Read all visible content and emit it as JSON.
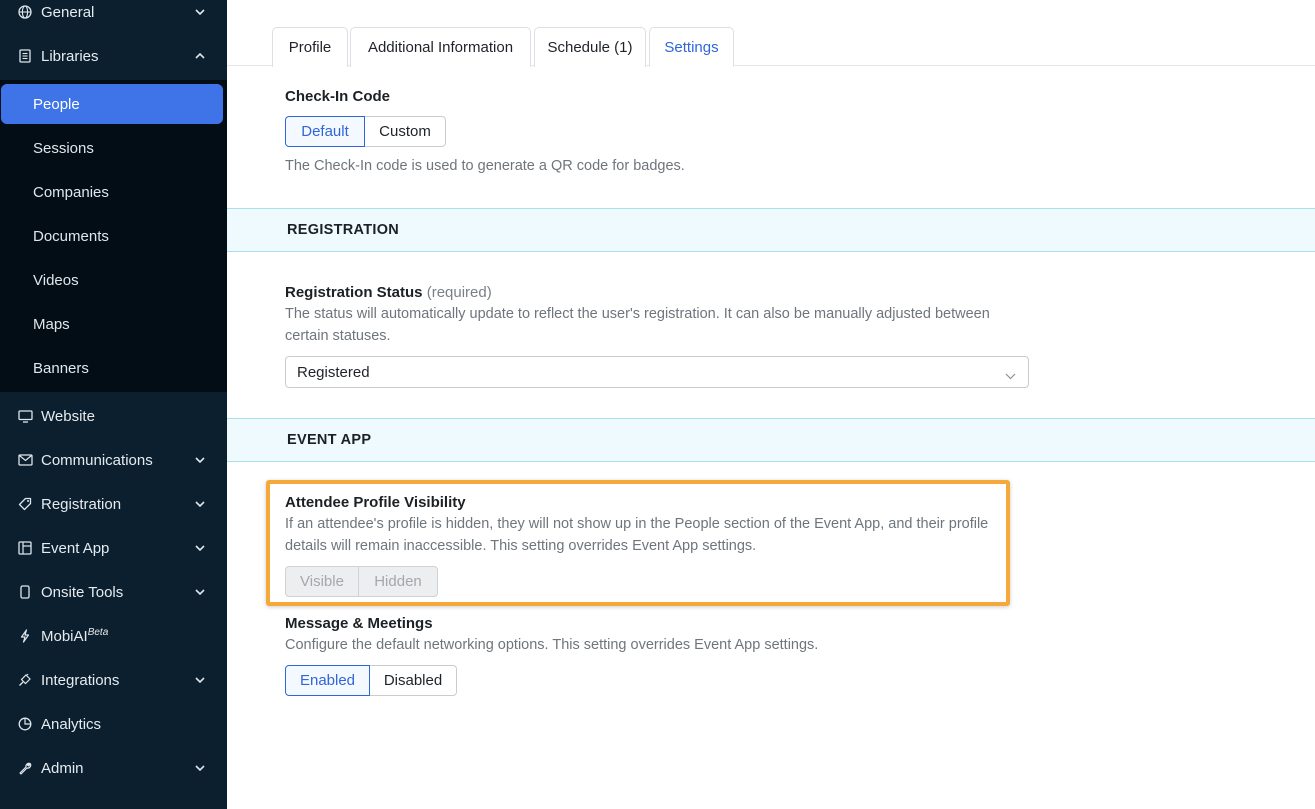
{
  "sidebar": {
    "items": [
      {
        "label": "General",
        "icon": "globe-icon"
      },
      {
        "label": "Libraries",
        "icon": "book-icon"
      },
      {
        "label": "Website",
        "icon": "monitor-icon"
      },
      {
        "label": "Communications",
        "icon": "mail-icon"
      },
      {
        "label": "Registration",
        "icon": "tag-icon"
      },
      {
        "label": "Event App",
        "icon": "layout-icon"
      },
      {
        "label": "Onsite Tools",
        "icon": "phone-icon"
      },
      {
        "label": "MobiAI",
        "icon": "bolt-icon",
        "superscript": "Beta"
      },
      {
        "label": "Integrations",
        "icon": "plug-icon"
      },
      {
        "label": "Analytics",
        "icon": "pie-chart-icon"
      },
      {
        "label": "Admin",
        "icon": "wrench-icon"
      }
    ],
    "library_items": [
      "People",
      "Sessions",
      "Companies",
      "Documents",
      "Videos",
      "Maps",
      "Banners"
    ],
    "active_library_item": "People"
  },
  "tabs": [
    "Profile",
    "Additional Information",
    "Schedule (1)",
    "Settings"
  ],
  "active_tab": "Settings",
  "checkin": {
    "title": "Check-In Code",
    "options": [
      "Default",
      "Custom"
    ],
    "selected": "Default",
    "help": "The Check-In code is used to generate a QR code for badges."
  },
  "registration_section": {
    "heading": "REGISTRATION",
    "status_title": "Registration Status",
    "status_required": "(required)",
    "status_help": "The status will automatically update to reflect the user's registration. It can also be manually adjusted between certain statuses.",
    "status_value": "Registered"
  },
  "event_app_section": {
    "heading": "EVENT APP",
    "visibility_title": "Attendee Profile Visibility",
    "visibility_help": "If an attendee's profile is hidden, they will not show up in the People section of the Event App, and their profile details will remain inaccessible. This setting overrides Event App settings.",
    "visibility_options": [
      "Visible",
      "Hidden"
    ],
    "messaging_title": "Message & Meetings",
    "messaging_help": "Configure the default networking options. This setting overrides Event App settings.",
    "messaging_options": [
      "Enabled",
      "Disabled"
    ],
    "messaging_selected": "Enabled"
  },
  "colors": {
    "sidebar_bg": "#0b1f2e",
    "active_item": "#3f74e8",
    "accent": "#3166d8",
    "highlight_border": "#f4a93a",
    "section_band": "#eefafd"
  }
}
